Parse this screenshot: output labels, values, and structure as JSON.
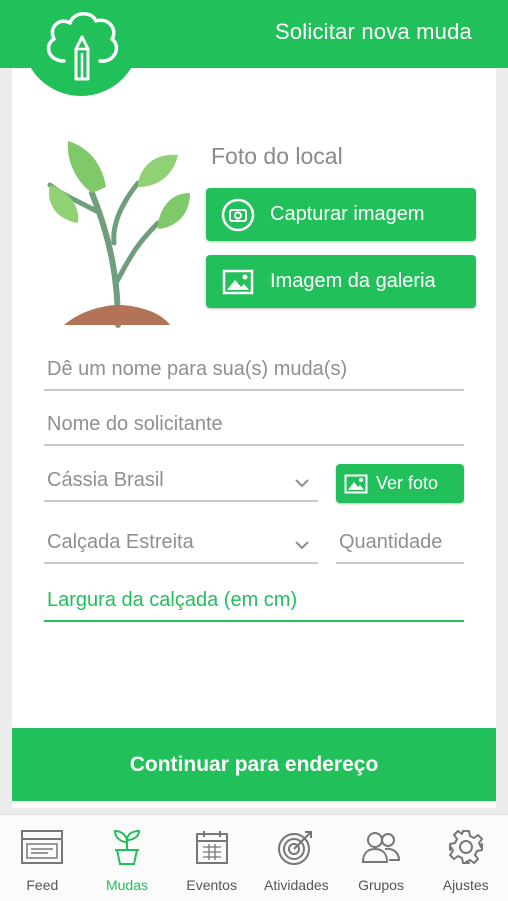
{
  "colors": {
    "accent": "#22c05a",
    "background": "#ececec",
    "card": "#ffffff",
    "field_line": "#c9c9c9",
    "placeholder": "#8f8f8f"
  },
  "header": {
    "title": "Solicitar nova muda",
    "logo_icon": "tree-pencil-logo-icon"
  },
  "photo": {
    "illustration_icon": "sprout-plant-icon",
    "label": "Foto do local",
    "capture_button": {
      "label": "Capturar imagem",
      "icon": "camera-icon"
    },
    "gallery_button": {
      "label": "Imagem da galeria",
      "icon": "image-icon"
    }
  },
  "form": {
    "seedling_name": {
      "placeholder": "Dê um nome para sua(s) muda(s)",
      "value": ""
    },
    "requester_name": {
      "placeholder": "Nome do solicitante",
      "value": ""
    },
    "species": {
      "value": "Cássia Brasil"
    },
    "view_photo_button": {
      "label": "Ver foto",
      "icon": "image-icon"
    },
    "sidewalk_type": {
      "value": "Calçada Estreita"
    },
    "quantity": {
      "placeholder": "Quantidade",
      "value": ""
    },
    "sidewalk_width": {
      "placeholder": "Largura da calçada (em cm)",
      "value": "",
      "focused": true
    }
  },
  "continue_button": {
    "label": "Continuar para endereço"
  },
  "bottom_nav": {
    "active": "Mudas",
    "items": [
      {
        "label": "Feed",
        "icon": "feed-icon"
      },
      {
        "label": "Mudas",
        "icon": "seedling-icon"
      },
      {
        "label": "Eventos",
        "icon": "calendar-icon"
      },
      {
        "label": "Atividades",
        "icon": "target-icon"
      },
      {
        "label": "Grupos",
        "icon": "group-icon"
      },
      {
        "label": "Ajustes",
        "icon": "gear-icon"
      }
    ]
  }
}
